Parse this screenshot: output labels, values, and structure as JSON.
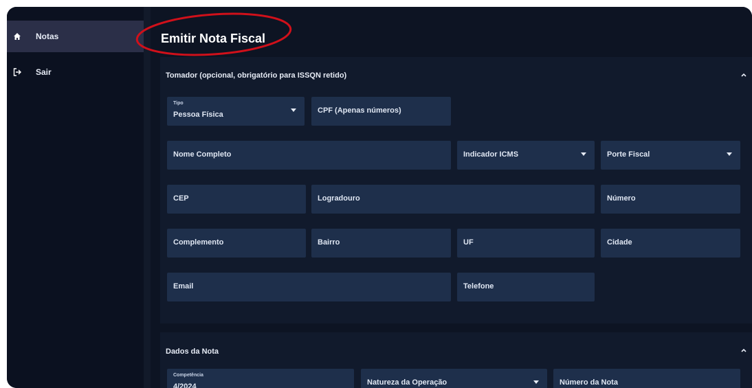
{
  "sidebar": {
    "items": [
      {
        "label": "Notas",
        "icon": "home-icon"
      },
      {
        "label": "Sair",
        "icon": "logout-icon"
      }
    ]
  },
  "main": {
    "title": "Emitir Nota Fiscal",
    "tomador": {
      "header": "Tomador (opcional, obrigatório para ISSQN retido)",
      "tipo_label": "Tipo",
      "tipo_value": "Pessoa Física",
      "cpf": "CPF (Apenas números)",
      "nome": "Nome Completo",
      "indicador_icms": "Indicador ICMS",
      "porte_fiscal": "Porte Fiscal",
      "cep": "CEP",
      "logradouro": "Logradouro",
      "numero": "Número",
      "complemento": "Complemento",
      "bairro": "Bairro",
      "uf": "UF",
      "cidade": "Cidade",
      "email": "Email",
      "telefone": "Telefone"
    },
    "dados_nota": {
      "header": "Dados da Nota",
      "competencia_label": "Competência",
      "competencia_value": "4/2024",
      "natureza": "Natureza da Operação",
      "numero_nota": "Número da Nota"
    }
  },
  "colors": {
    "accent_annotation": "#d0101a",
    "field_bg": "#1e2f4b",
    "panel_bg": "#111a2c"
  }
}
